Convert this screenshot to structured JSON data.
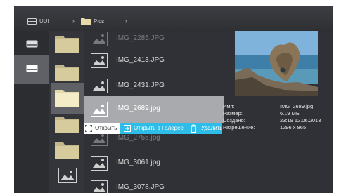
{
  "breadcrumb": {
    "drive": "UUI",
    "folder": "Pics"
  },
  "files": [
    {
      "label": "IMG_2285.JPG"
    },
    {
      "label": "IMG_2413.JPG"
    },
    {
      "label": "IMG_2431.JPG"
    },
    {
      "label": "IMG_2689.jpg"
    },
    {
      "label": "IMG_2755.jpg"
    },
    {
      "label": "IMG_3061.jpg"
    },
    {
      "label": "IMG_3078.JPG"
    }
  ],
  "context_menu": {
    "open": "Открыть",
    "open_gallery": "Открыть в Галерее",
    "delete": "Удалить"
  },
  "info": {
    "name_label": "Имя:",
    "name_value": "IMG_2689.jpg",
    "size_label": "Размер:",
    "size_value": "6.19 МБ",
    "created_label": "Создано:",
    "created_value": "23:19 12.06.2013",
    "resolution_label": "Разрешение:",
    "resolution_value": "1296 x 865"
  },
  "colors": {
    "background": "#2f3136",
    "selected": "#a8aaad",
    "accent": "#2ebde8"
  }
}
